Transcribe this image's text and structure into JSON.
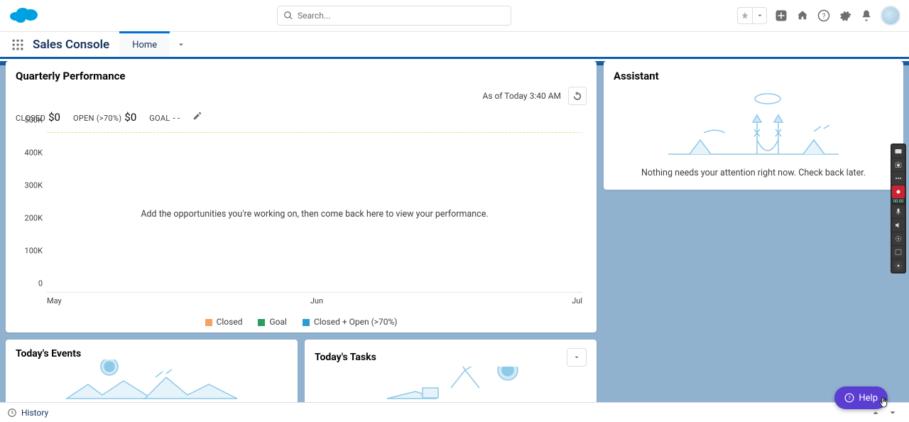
{
  "search_placeholder": "Search...",
  "app_name": "Sales Console",
  "tab_home": "Home",
  "quarterly": {
    "title": "Quarterly Performance",
    "as_of": "As of Today 3:40 AM",
    "closed_label": "CLOSED",
    "closed_value": "$0",
    "open_label": "OPEN (>70%)",
    "open_value": "$0",
    "goal_label": "GOAL",
    "goal_value": "- -",
    "empty_msg": "Add the opportunities you're working on, then come back here to view your performance."
  },
  "legend": {
    "closed": "Closed",
    "goal": "Goal",
    "combo": "Closed + Open (>70%)"
  },
  "events_title": "Today's Events",
  "tasks_title": "Today's Tasks",
  "assistant": {
    "title": "Assistant",
    "msg": "Nothing needs your attention right now. Check back later."
  },
  "footer_history": "History",
  "help_label": "Help",
  "colors": {
    "closed": "#f4a261",
    "goal": "#2a9d5b",
    "combo": "#299dd4"
  },
  "chart_data": {
    "type": "line",
    "title": "Quarterly Performance",
    "xlabel": "",
    "ylabel": "",
    "categories": [
      "May",
      "Jun",
      "Jul"
    ],
    "ylim": [
      0,
      500000
    ],
    "yticks": [
      "0",
      "100K",
      "200K",
      "300K",
      "400K",
      "500K"
    ],
    "series": [
      {
        "name": "Closed",
        "values": [
          0,
          0,
          0
        ]
      },
      {
        "name": "Goal",
        "values": [
          null,
          null,
          null
        ]
      },
      {
        "name": "Closed + Open (>70%)",
        "values": [
          0,
          0,
          0
        ]
      }
    ],
    "legend_position": "bottom",
    "grid": true,
    "empty": true
  }
}
